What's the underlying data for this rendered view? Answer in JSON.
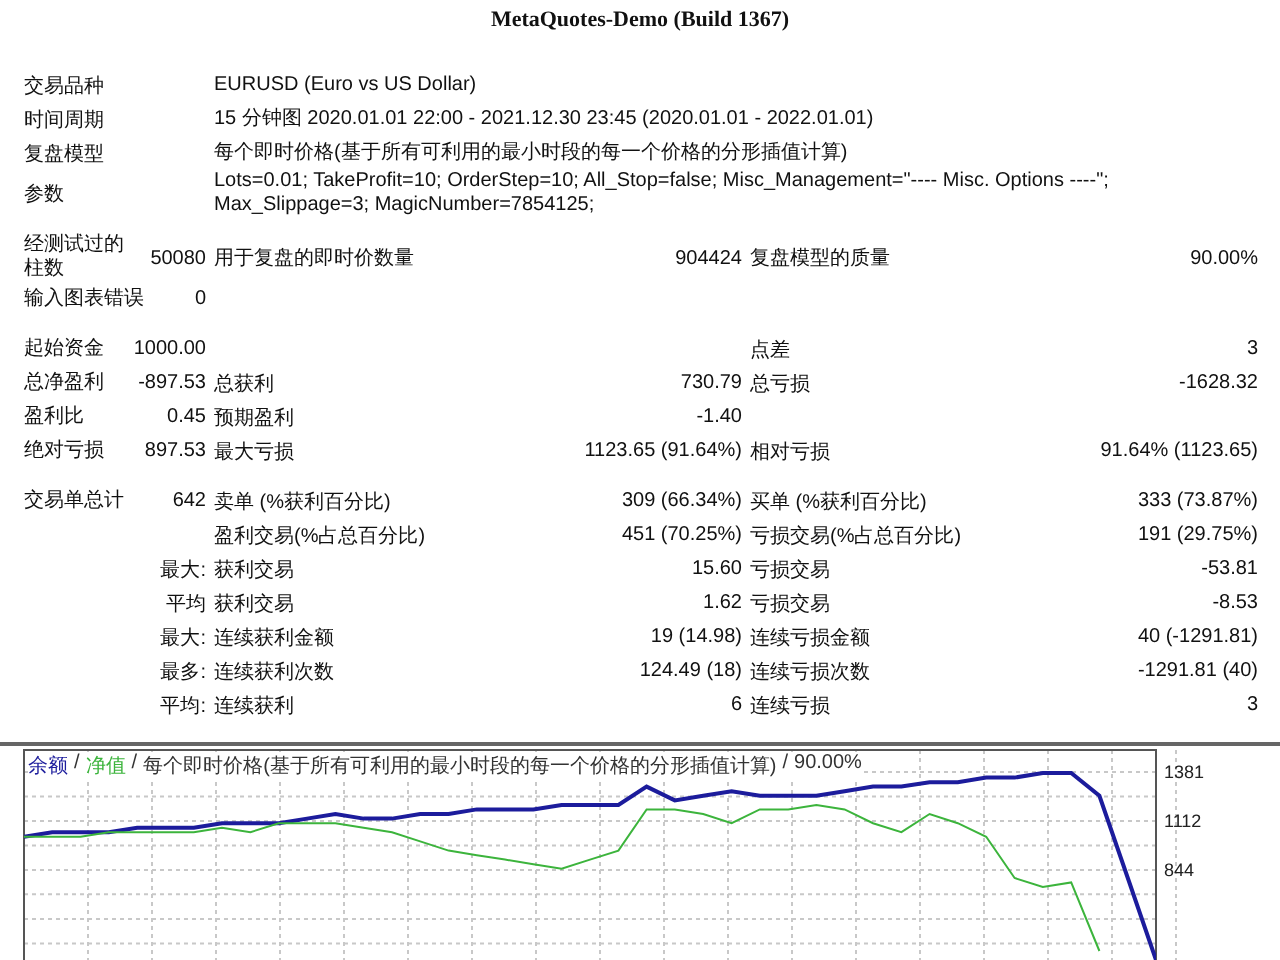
{
  "header": {
    "server": "MetaQuotes-Demo (Build 1367)"
  },
  "info": [
    {
      "label": "交易品种",
      "text": "EURUSD (Euro vs US Dollar)"
    },
    {
      "label": "时间周期",
      "text": "15 分钟图 2020.01.01 22:00 - 2021.12.30 23:45 (2020.01.01 - 2022.01.01)"
    },
    {
      "label": "复盘模型",
      "text": "每个即时价格(基于所有可利用的最小时段的每一个价格的分形插值计算)"
    },
    {
      "label": "参数",
      "text": "Lots=0.01; TakeProfit=10; OrderStep=10; All_Stop=false; Misc_Management=\"---- Misc. Options ----\"; Max_Slippage=3; MagicNumber=7854125;"
    }
  ],
  "sections": [
    {
      "rows": [
        {
          "left": {
            "label": "经测试过的柱数",
            "value": "50080"
          },
          "middle": {
            "label": "用于复盘的即时价数量",
            "value": "904424"
          },
          "right": {
            "label": "复盘模型的质量",
            "value": "90.00%"
          }
        },
        {
          "left": {
            "label": "输入图表错误",
            "value": "0"
          }
        }
      ]
    },
    {
      "rows": [
        {
          "left": {
            "label": "起始资金",
            "value": "1000.00"
          },
          "right": {
            "label": "点差",
            "value": "3"
          }
        },
        {
          "left": {
            "label": "总净盈利",
            "value": "-897.53"
          },
          "middle": {
            "label": "总获利",
            "value": "730.79"
          },
          "right": {
            "label": "总亏损",
            "value": "-1628.32"
          }
        },
        {
          "left": {
            "label": "盈利比",
            "value": "0.45"
          },
          "middle": {
            "label": "预期盈利",
            "value": "-1.40"
          }
        },
        {
          "left": {
            "label": "绝对亏损",
            "value": "897.53"
          },
          "middle": {
            "label": "最大亏损",
            "value": "1123.65 (91.64%)"
          },
          "right": {
            "label": "相对亏损",
            "value": "91.64% (1123.65)"
          }
        }
      ]
    },
    {
      "rows": [
        {
          "left": {
            "label": "交易单总计",
            "value": "642"
          },
          "middle": {
            "label": "卖单 (%获利百分比)",
            "value": "309 (66.34%)"
          },
          "right": {
            "label": "买单 (%获利百分比)",
            "value": "333 (73.87%)"
          }
        },
        {
          "middle": {
            "label": "盈利交易(%占总百分比)",
            "value": "451 (70.25%)"
          },
          "right": {
            "label": "亏损交易(%占总百分比)",
            "value": "191 (29.75%)"
          }
        },
        {
          "left": {
            "value": "最大:"
          },
          "middle": {
            "label": "获利交易",
            "value": "15.60"
          },
          "right": {
            "label": "亏损交易",
            "value": "-53.81"
          }
        },
        {
          "left": {
            "value": "平均"
          },
          "middle": {
            "label": "获利交易",
            "value": "1.62"
          },
          "right": {
            "label": "亏损交易",
            "value": "-8.53"
          }
        },
        {
          "left": {
            "value": "最大:"
          },
          "middle": {
            "label": "连续获利金额",
            "value": "19 (14.98)"
          },
          "right": {
            "label": "连续亏损金额",
            "value": "40 (-1291.81)"
          }
        },
        {
          "left": {
            "value": "最多:"
          },
          "middle": {
            "label": "连续获利次数",
            "value": "124.49 (18)"
          },
          "right": {
            "label": "连续亏损次数",
            "value": "-1291.81 (40)"
          }
        },
        {
          "left": {
            "value": "平均:"
          },
          "middle": {
            "label": "连续获利",
            "value": "6"
          },
          "right": {
            "label": "连续亏损",
            "value": "3"
          }
        }
      ]
    }
  ],
  "chart": {
    "separator": "/",
    "model_note": "每个即时价格(基于所有可利用的最小时段的每一个价格的分形插值计算)",
    "quality": "90.00%",
    "chart_data": {
      "type": "line",
      "grid": true,
      "ylim": [
        320,
        1490
      ],
      "yticks": [
        844,
        1112,
        1381
      ],
      "series": [
        {
          "name": "余额",
          "color": "#1c1c9c",
          "values": [
            1025,
            1050,
            1050,
            1050,
            1075,
            1075,
            1075,
            1100,
            1100,
            1100,
            1125,
            1150,
            1125,
            1125,
            1150,
            1150,
            1175,
            1175,
            1175,
            1200,
            1200,
            1200,
            1300,
            1225,
            1250,
            1275,
            1250,
            1250,
            1250,
            1275,
            1300,
            1300,
            1325,
            1325,
            1350,
            1350,
            1375,
            1375,
            1250,
            800,
            350
          ]
        },
        {
          "name": "净值",
          "color": "#3cb43c",
          "values": [
            1025,
            1025,
            1025,
            1050,
            1050,
            1050,
            1050,
            1075,
            1050,
            1100,
            1100,
            1100,
            1075,
            1050,
            1000,
            950,
            925,
            900,
            875,
            850,
            900,
            950,
            1175,
            1175,
            1150,
            1100,
            1175,
            1175,
            1200,
            1175,
            1100,
            1050,
            1150,
            1100,
            1025,
            800,
            750,
            775,
            400,
            null,
            null
          ]
        }
      ]
    }
  }
}
